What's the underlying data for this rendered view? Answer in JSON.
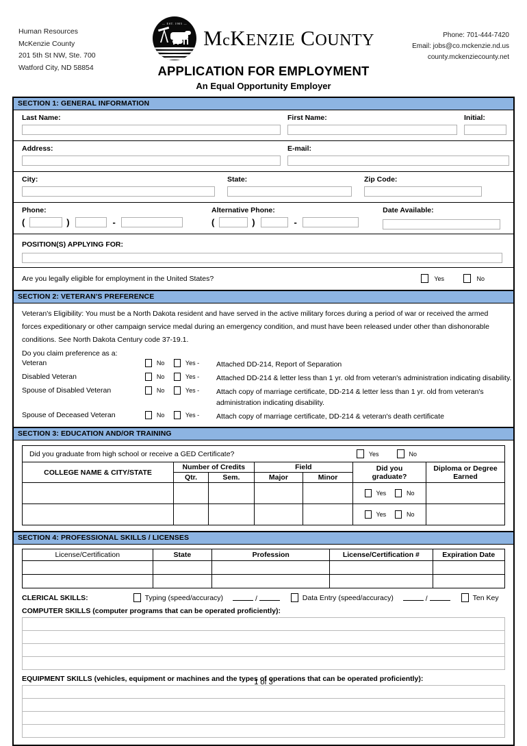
{
  "header": {
    "address_lines": [
      "Human Resources",
      "McKenzie County",
      "201 5th St NW, Ste. 700",
      "Watford City, ND  58854"
    ],
    "contact_lines": [
      "Phone: 701-444-7420",
      "Email: jobs@co.mckenzie.nd.us",
      "county.mckenziecounty.net"
    ],
    "seal_est": "EST. 1905",
    "county_name_mc": "M",
    "county_name_c": "c",
    "county_name_rest_1": "K",
    "county_name_rest_2": "ENZIE",
    "county_name_rest_3": "C",
    "county_name_rest_4": "OUNTY",
    "title": "APPLICATION FOR EMPLOYMENT",
    "subtitle": "An Equal Opportunity Employer"
  },
  "section1": {
    "heading": "SECTION 1:  GENERAL INFORMATION",
    "last_name_label": "Last Name:",
    "first_name_label": "First Name:",
    "initial_label": "Initial:",
    "address_label": "Address:",
    "email_label": "E-mail:",
    "city_label": "City:",
    "state_label": "State:",
    "zip_label": "Zip Code:",
    "phone_label": "Phone:",
    "alt_phone_label": "Alternative Phone:",
    "date_available_label": "Date Available:",
    "paren_open": "(",
    "paren_close": ")",
    "dash": "-",
    "position_label": "POSITION(S) APPLYING FOR:",
    "eligibility_question": "Are you legally eligible for employment in the United States?",
    "yes": "Yes",
    "no": "No"
  },
  "section2": {
    "heading": "SECTION 2:  VETERAN'S PREFERENCE",
    "eligibility_text": "Veteran's Eligibility: You must be a North Dakota resident and have served in the active military forces during a period of war or received the armed forces expeditionary or other campaign service medal during an emergency condition, and must have been released under other than dishonorable conditions. See North Dakota Century code 37-19.1.",
    "claim_label": "Do you claim preference as a:",
    "no": "No",
    "yes_dash": "Yes -",
    "rows": [
      {
        "name": "Veteran",
        "desc": "Attached DD-214, Report of Separation"
      },
      {
        "name": "Disabled Veteran",
        "desc": "Attached DD-214 & letter less than 1 yr. old from veteran's administration indicating disability."
      },
      {
        "name": "Spouse of Disabled Veteran",
        "desc": "Attach copy of marriage certificate, DD-214 & letter less than 1 yr. old from veteran's administration indicating disability."
      },
      {
        "name": "Spouse of Deceased Veteran",
        "desc": "Attach copy of marriage certificate, DD-214 & veteran's death certificate"
      }
    ]
  },
  "section3": {
    "heading": "SECTION 3:  EDUCATION AND/OR TRAINING",
    "grad_question": "Did you graduate from high school or receive a GED Certificate?",
    "yes": "Yes",
    "no": "No",
    "col_college": "COLLEGE NAME & CITY/STATE",
    "col_credits": "Number of Credits",
    "col_qtr": "Qtr.",
    "col_sem": "Sem.",
    "col_field": "Field",
    "col_major": "Major",
    "col_minor": "Minor",
    "col_graduate_1": "Did you",
    "col_graduate_2": "graduate?",
    "col_diploma_1": "Diploma or Degree",
    "col_diploma_2": "Earned",
    "row_count": 2
  },
  "section4": {
    "heading": "SECTION 4:  PROFESSIONAL SKILLS / LICENSES",
    "col_license": "License/Certification",
    "col_state": "State",
    "col_profession": "Profession",
    "col_license_num": "License/Certification #",
    "col_expiration": "Expiration Date",
    "row_count": 2,
    "clerical_label": "CLERICAL SKILLS:",
    "typing_label": "Typing (speed/accuracy)",
    "data_entry_label": "Data Entry (speed/accuracy)",
    "ten_key_label": "Ten Key",
    "slash": "/",
    "computer_skills_label": "COMPUTER SKILLS (computer programs that can be operated proficiently):",
    "computer_skill_lines": 4,
    "equipment_skills_label": "EQUIPMENT SKILLS (vehicles, equipment or machines and the types of operations that can be operated proficiently):",
    "equipment_skill_lines": 4
  },
  "footer": {
    "page_label": "1 of 3"
  },
  "colors": {
    "section_header_blue": "#8db4e2",
    "border_black": "#000000",
    "input_border": "#b0b0b0"
  }
}
